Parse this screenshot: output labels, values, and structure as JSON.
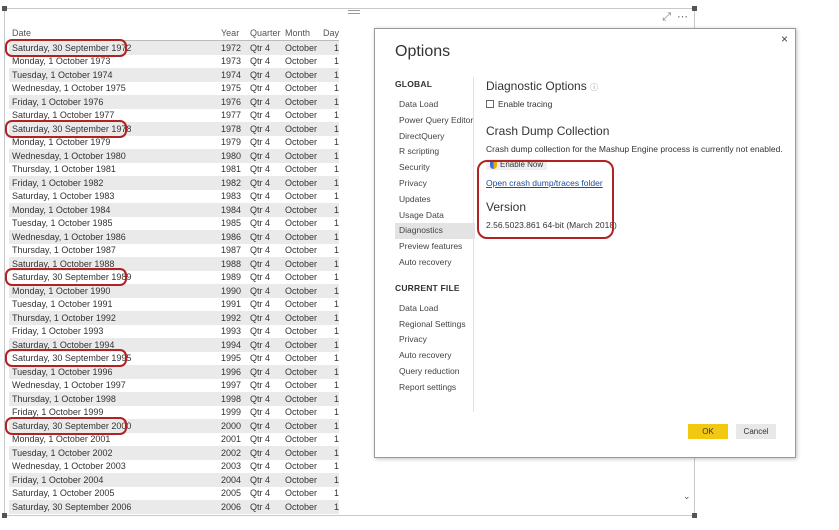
{
  "table": {
    "headers": {
      "date": "Date",
      "year": "Year",
      "quarter": "Quarter",
      "month": "Month",
      "day": "Day"
    },
    "rows": [
      {
        "date": "Saturday, 30 September 1972",
        "year": "1972",
        "quarter": "Qtr 4",
        "month": "October",
        "day": "1"
      },
      {
        "date": "Monday, 1 October 1973",
        "year": "1973",
        "quarter": "Qtr 4",
        "month": "October",
        "day": "1"
      },
      {
        "date": "Tuesday, 1 October 1974",
        "year": "1974",
        "quarter": "Qtr 4",
        "month": "October",
        "day": "1"
      },
      {
        "date": "Wednesday, 1 October 1975",
        "year": "1975",
        "quarter": "Qtr 4",
        "month": "October",
        "day": "1"
      },
      {
        "date": "Friday, 1 October 1976",
        "year": "1976",
        "quarter": "Qtr 4",
        "month": "October",
        "day": "1"
      },
      {
        "date": "Saturday, 1 October 1977",
        "year": "1977",
        "quarter": "Qtr 4",
        "month": "October",
        "day": "1"
      },
      {
        "date": "Saturday, 30 September 1978",
        "year": "1978",
        "quarter": "Qtr 4",
        "month": "October",
        "day": "1"
      },
      {
        "date": "Monday, 1 October 1979",
        "year": "1979",
        "quarter": "Qtr 4",
        "month": "October",
        "day": "1"
      },
      {
        "date": "Wednesday, 1 October 1980",
        "year": "1980",
        "quarter": "Qtr 4",
        "month": "October",
        "day": "1"
      },
      {
        "date": "Thursday, 1 October 1981",
        "year": "1981",
        "quarter": "Qtr 4",
        "month": "October",
        "day": "1"
      },
      {
        "date": "Friday, 1 October 1982",
        "year": "1982",
        "quarter": "Qtr 4",
        "month": "October",
        "day": "1"
      },
      {
        "date": "Saturday, 1 October 1983",
        "year": "1983",
        "quarter": "Qtr 4",
        "month": "October",
        "day": "1"
      },
      {
        "date": "Monday, 1 October 1984",
        "year": "1984",
        "quarter": "Qtr 4",
        "month": "October",
        "day": "1"
      },
      {
        "date": "Tuesday, 1 October 1985",
        "year": "1985",
        "quarter": "Qtr 4",
        "month": "October",
        "day": "1"
      },
      {
        "date": "Wednesday, 1 October 1986",
        "year": "1986",
        "quarter": "Qtr 4",
        "month": "October",
        "day": "1"
      },
      {
        "date": "Thursday, 1 October 1987",
        "year": "1987",
        "quarter": "Qtr 4",
        "month": "October",
        "day": "1"
      },
      {
        "date": "Saturday, 1 October 1988",
        "year": "1988",
        "quarter": "Qtr 4",
        "month": "October",
        "day": "1"
      },
      {
        "date": "Saturday, 30 September 1989",
        "year": "1989",
        "quarter": "Qtr 4",
        "month": "October",
        "day": "1"
      },
      {
        "date": "Monday, 1 October 1990",
        "year": "1990",
        "quarter": "Qtr 4",
        "month": "October",
        "day": "1"
      },
      {
        "date": "Tuesday, 1 October 1991",
        "year": "1991",
        "quarter": "Qtr 4",
        "month": "October",
        "day": "1"
      },
      {
        "date": "Thursday, 1 October 1992",
        "year": "1992",
        "quarter": "Qtr 4",
        "month": "October",
        "day": "1"
      },
      {
        "date": "Friday, 1 October 1993",
        "year": "1993",
        "quarter": "Qtr 4",
        "month": "October",
        "day": "1"
      },
      {
        "date": "Saturday, 1 October 1994",
        "year": "1994",
        "quarter": "Qtr 4",
        "month": "October",
        "day": "1"
      },
      {
        "date": "Saturday, 30 September 1995",
        "year": "1995",
        "quarter": "Qtr 4",
        "month": "October",
        "day": "1"
      },
      {
        "date": "Tuesday, 1 October 1996",
        "year": "1996",
        "quarter": "Qtr 4",
        "month": "October",
        "day": "1"
      },
      {
        "date": "Wednesday, 1 October 1997",
        "year": "1997",
        "quarter": "Qtr 4",
        "month": "October",
        "day": "1"
      },
      {
        "date": "Thursday, 1 October 1998",
        "year": "1998",
        "quarter": "Qtr 4",
        "month": "October",
        "day": "1"
      },
      {
        "date": "Friday, 1 October 1999",
        "year": "1999",
        "quarter": "Qtr 4",
        "month": "October",
        "day": "1"
      },
      {
        "date": "Saturday, 30 September 2000",
        "year": "2000",
        "quarter": "Qtr 4",
        "month": "October",
        "day": "1"
      },
      {
        "date": "Monday, 1 October 2001",
        "year": "2001",
        "quarter": "Qtr 4",
        "month": "October",
        "day": "1"
      },
      {
        "date": "Tuesday, 1 October 2002",
        "year": "2002",
        "quarter": "Qtr 4",
        "month": "October",
        "day": "1"
      },
      {
        "date": "Wednesday, 1 October 2003",
        "year": "2003",
        "quarter": "Qtr 4",
        "month": "October",
        "day": "1"
      },
      {
        "date": "Friday, 1 October 2004",
        "year": "2004",
        "quarter": "Qtr 4",
        "month": "October",
        "day": "1"
      },
      {
        "date": "Saturday, 1 October 2005",
        "year": "2005",
        "quarter": "Qtr 4",
        "month": "October",
        "day": "1"
      },
      {
        "date": "Saturday, 30 September 2006",
        "year": "2006",
        "quarter": "Qtr 4",
        "month": "October",
        "day": "1"
      }
    ],
    "highlighted_rows": [
      0,
      6,
      17,
      23,
      28
    ]
  },
  "visual_icons": {
    "focus": "focus-mode-icon",
    "more": "more-options-icon"
  },
  "dialog": {
    "title": "Options",
    "close": "×",
    "global_heading": "GLOBAL",
    "global_items": [
      "Data Load",
      "Power Query Editor",
      "DirectQuery",
      "R scripting",
      "Security",
      "Privacy",
      "Updates",
      "Usage Data",
      "Diagnostics",
      "Preview features",
      "Auto recovery"
    ],
    "active_item": "Diagnostics",
    "current_file_heading": "CURRENT FILE",
    "current_file_items": [
      "Data Load",
      "Regional Settings",
      "Privacy",
      "Auto recovery",
      "Query reduction",
      "Report settings"
    ],
    "diagnostic_options_title": "Diagnostic Options",
    "info_glyph": "ⓘ",
    "enable_tracing_label": "Enable tracing",
    "crash_dump_title": "Crash Dump Collection",
    "crash_dump_text": "Crash dump collection for the Mashup Engine process is currently not enabled.",
    "enable_now_label": "Enable Now",
    "open_link_label": "Open crash dump/traces folder",
    "version_title": "Version",
    "version_value": "2.56.5023.861 64-bit (March 2018)",
    "ok_label": "OK",
    "cancel_label": "Cancel"
  },
  "colors": {
    "highlight_ring": "#b22222",
    "ok_button": "#f2c811",
    "link": "#1a4d9b"
  }
}
